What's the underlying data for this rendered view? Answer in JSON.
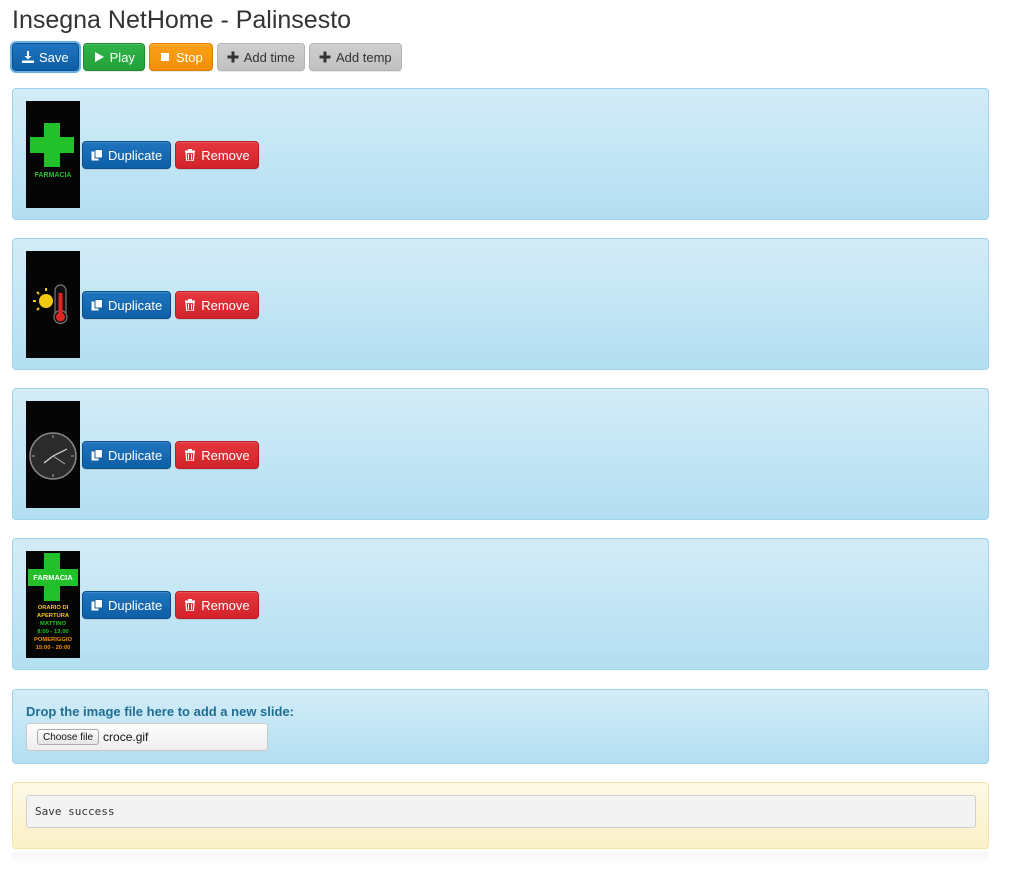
{
  "page": {
    "title": "Insegna NetHome - Palinsesto"
  },
  "toolbar": {
    "save_label": "Save",
    "play_label": "Play",
    "stop_label": "Stop",
    "add_time_label": "Add time",
    "add_temp_label": "Add temp"
  },
  "slides": [
    {
      "thumbnail": "pharmacy-cross",
      "thumb_text": "FARMACIA",
      "duplicate_label": "Duplicate",
      "remove_label": "Remove"
    },
    {
      "thumbnail": "sun-thermometer",
      "duplicate_label": "Duplicate",
      "remove_label": "Remove"
    },
    {
      "thumbnail": "analog-clock",
      "duplicate_label": "Duplicate",
      "remove_label": "Remove"
    },
    {
      "thumbnail": "pharmacy-hours",
      "thumb_title": "FARMACIA",
      "thumb_line1": "ORARIO DI",
      "thumb_line2": "APERTURA",
      "thumb_line3": "MATTINO",
      "thumb_line4": "8:00 - 13:00",
      "thumb_line5": "POMERIGGIO",
      "thumb_line6": "15:00 - 20:00",
      "duplicate_label": "Duplicate",
      "remove_label": "Remove"
    }
  ],
  "upload": {
    "label": "Drop the image file here to add a new slide:",
    "choose_label": "Choose file",
    "file_name": "croce.gif"
  },
  "status": {
    "message": "Save success"
  },
  "colors": {
    "primary": "#0d5fa6",
    "success": "#23a03a",
    "warning": "#f28f06",
    "danger": "#d2232a",
    "panel_info": "#b3dff2",
    "panel_warning": "#fbf0c6"
  }
}
